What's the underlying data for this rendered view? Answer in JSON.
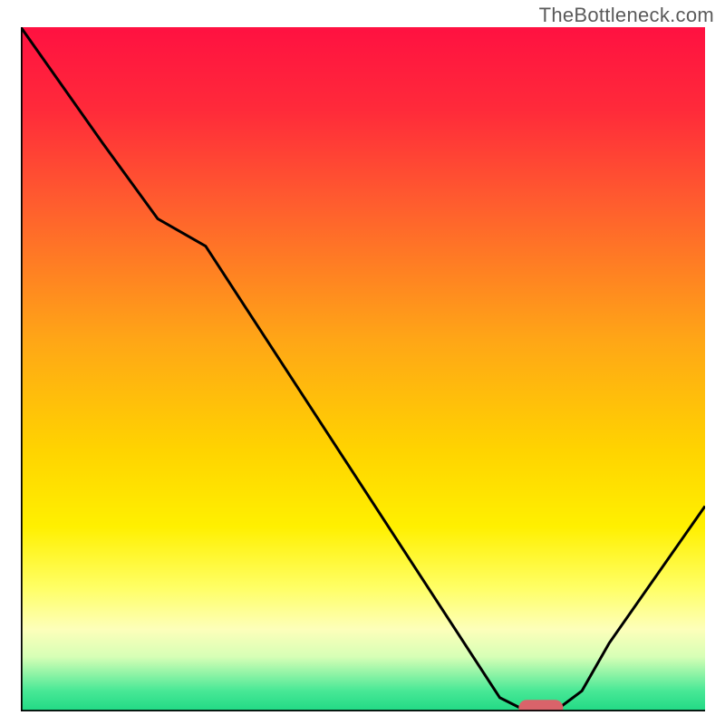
{
  "watermark": "TheBottleneck.com",
  "chart_data": {
    "type": "line",
    "title": "",
    "xlabel": "",
    "ylabel": "",
    "xlim": [
      0,
      100
    ],
    "ylim": [
      0,
      100
    ],
    "series": [
      {
        "name": "curve",
        "x": [
          0,
          12,
          20,
          27,
          70,
          74,
          78,
          82,
          86,
          100
        ],
        "values": [
          100,
          83,
          72,
          68,
          2,
          0,
          0,
          3,
          10,
          30
        ]
      }
    ],
    "marker": {
      "x_center": 76,
      "y_center": 0.5,
      "width": 6.5,
      "height": 2.4
    },
    "gradient_stops": [
      {
        "offset": 0.0,
        "color": "#ff1141"
      },
      {
        "offset": 0.12,
        "color": "#ff2a3a"
      },
      {
        "offset": 0.25,
        "color": "#ff5a2f"
      },
      {
        "offset": 0.46,
        "color": "#ffa716"
      },
      {
        "offset": 0.62,
        "color": "#ffd400"
      },
      {
        "offset": 0.73,
        "color": "#fff000"
      },
      {
        "offset": 0.82,
        "color": "#ffff66"
      },
      {
        "offset": 0.88,
        "color": "#fdffba"
      },
      {
        "offset": 0.92,
        "color": "#d7ffb6"
      },
      {
        "offset": 0.97,
        "color": "#48e896"
      },
      {
        "offset": 1.0,
        "color": "#20d984"
      }
    ],
    "axis_color": "#000000",
    "line_color": "#000000",
    "marker_color": "#d9636a"
  }
}
